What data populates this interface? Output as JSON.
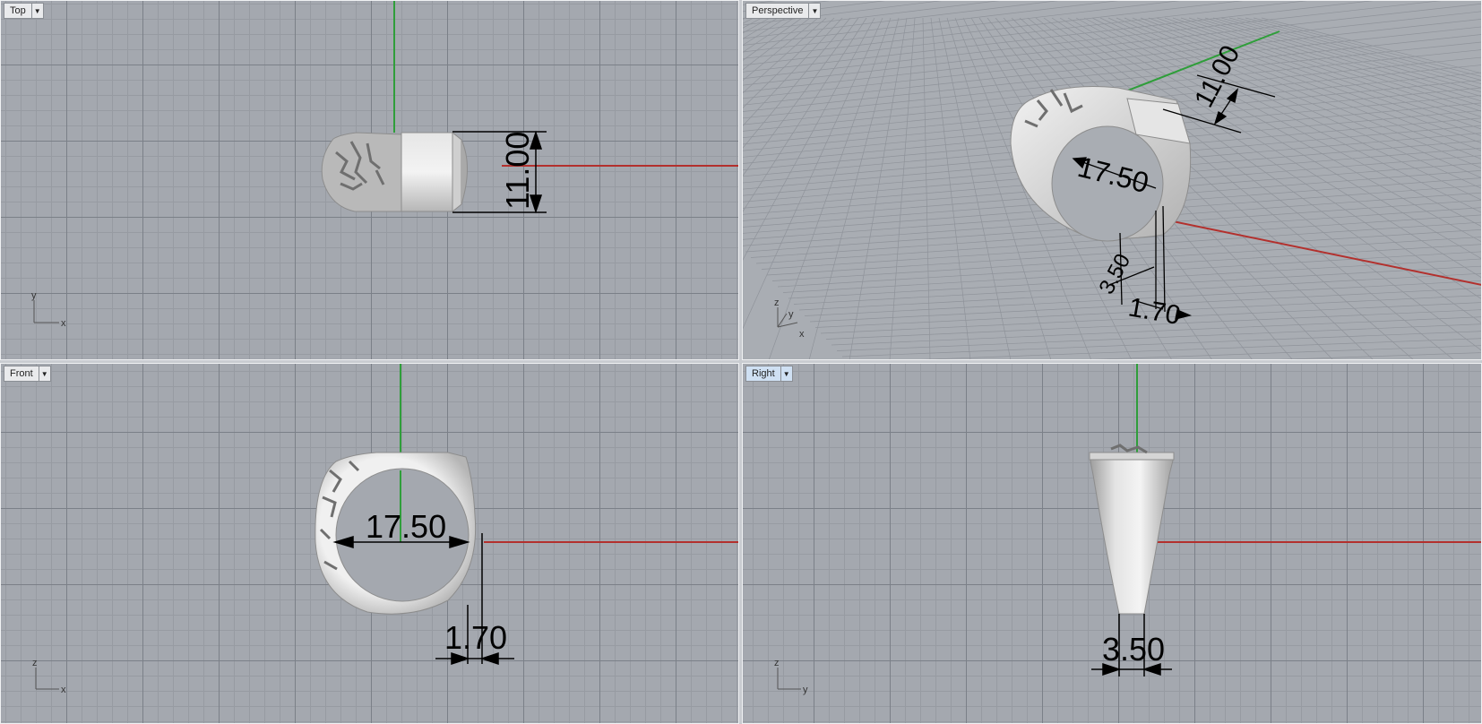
{
  "viewports": {
    "top": {
      "label": "Top",
      "dims": {
        "width": "11.00"
      }
    },
    "perspective": {
      "label": "Perspective",
      "dims": {
        "width": "11.00",
        "diameter": "17.50",
        "band": "3.50",
        "thickness": "1.70"
      }
    },
    "front": {
      "label": "Front",
      "dims": {
        "diameter": "17.50",
        "thickness": "1.70"
      }
    },
    "right": {
      "label": "Right",
      "dims": {
        "band": "3.50"
      }
    }
  },
  "axes": {
    "x": "x",
    "y": "y",
    "z": "z"
  },
  "icons": {
    "viewport_menu": "dropdown-arrow-icon"
  },
  "colors": {
    "x_axis": "#b3302d",
    "y_axis": "#2f9e3a",
    "grid": "#a4a8af",
    "active_tab": "#cfe0f3"
  }
}
